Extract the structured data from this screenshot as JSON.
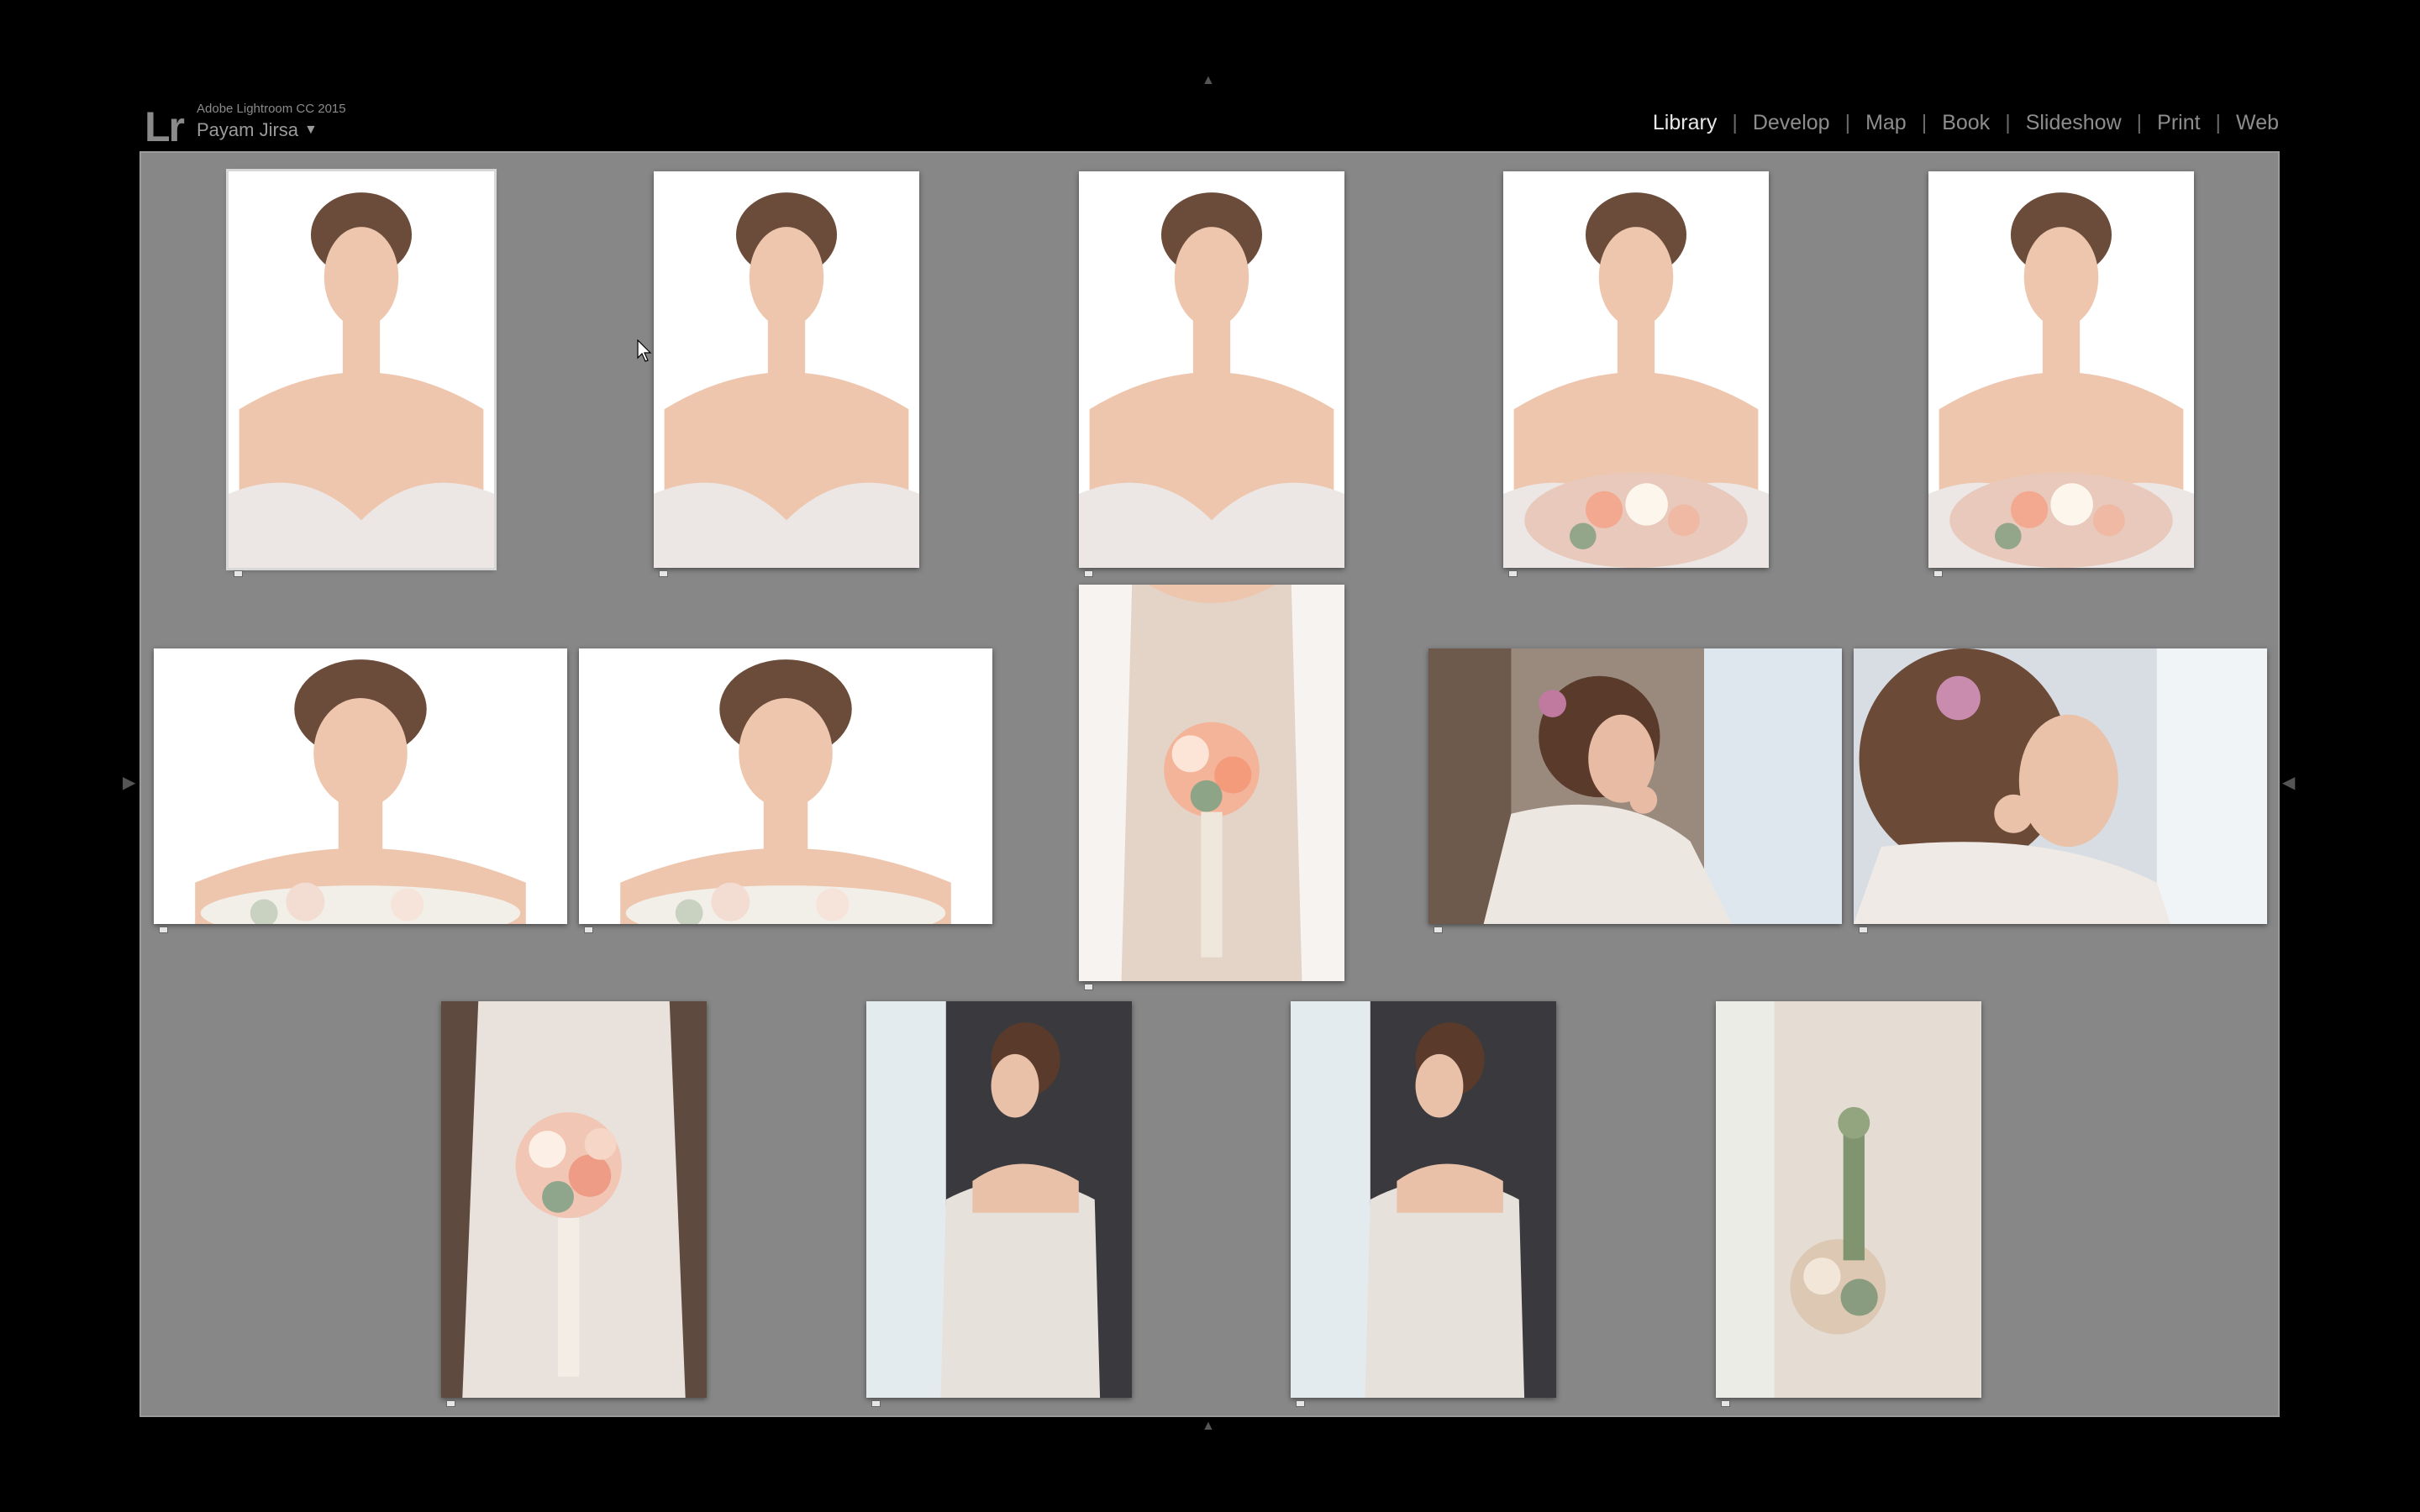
{
  "app": {
    "logo_text": "Lr",
    "product_name": "Adobe Lightroom CC 2015",
    "user_name": "Payam Jirsa",
    "user_menu_caret": "▼"
  },
  "modules": [
    {
      "label": "Library",
      "active": true
    },
    {
      "label": "Develop",
      "active": false
    },
    {
      "label": "Map",
      "active": false
    },
    {
      "label": "Book",
      "active": false
    },
    {
      "label": "Slideshow",
      "active": false
    },
    {
      "label": "Print",
      "active": false
    },
    {
      "label": "Web",
      "active": false
    }
  ],
  "module_separator": "|",
  "panel_toggles": {
    "top": "▲",
    "bottom": "▲",
    "left": "◀",
    "right": "◀"
  },
  "photos": [
    {
      "subject": "bride portrait, neutral expression, white background",
      "orientation": "portrait"
    },
    {
      "subject": "bride portrait, eyes down, white background",
      "orientation": "portrait"
    },
    {
      "subject": "bride portrait, smiling, white background",
      "orientation": "portrait"
    },
    {
      "subject": "bride portrait with bouquet, eyes down",
      "orientation": "portrait"
    },
    {
      "subject": "bride portrait with bouquet, smiling",
      "orientation": "portrait"
    },
    {
      "subject": "bride close-up, eyes down, bouquet below",
      "orientation": "landscape"
    },
    {
      "subject": "bride close-up, big smile, bouquet below",
      "orientation": "landscape"
    },
    {
      "subject": "lace gown holding bouquet with ribbons",
      "orientation": "portrait"
    },
    {
      "subject": "bride adjusting earring by window",
      "orientation": "landscape"
    },
    {
      "subject": "bride close-up adjusting earring, flower in hair",
      "orientation": "landscape"
    },
    {
      "subject": "bride holding bouquet against gown, dark background",
      "orientation": "portrait"
    },
    {
      "subject": "bride from behind by window, looking down",
      "orientation": "portrait"
    },
    {
      "subject": "bride from behind by window, smiling",
      "orientation": "portrait"
    },
    {
      "subject": "gown detail with bouquet by curtain",
      "orientation": "portrait"
    }
  ],
  "colors": {
    "grid_background": "#878787",
    "app_background": "#000000",
    "active_module": "#e8e8e8",
    "inactive_module": "#8d8d8d"
  },
  "icons": {
    "cursor": "arrow-pointer-icon",
    "thumb_badge": "unsaved-metadata-badge-icon"
  }
}
